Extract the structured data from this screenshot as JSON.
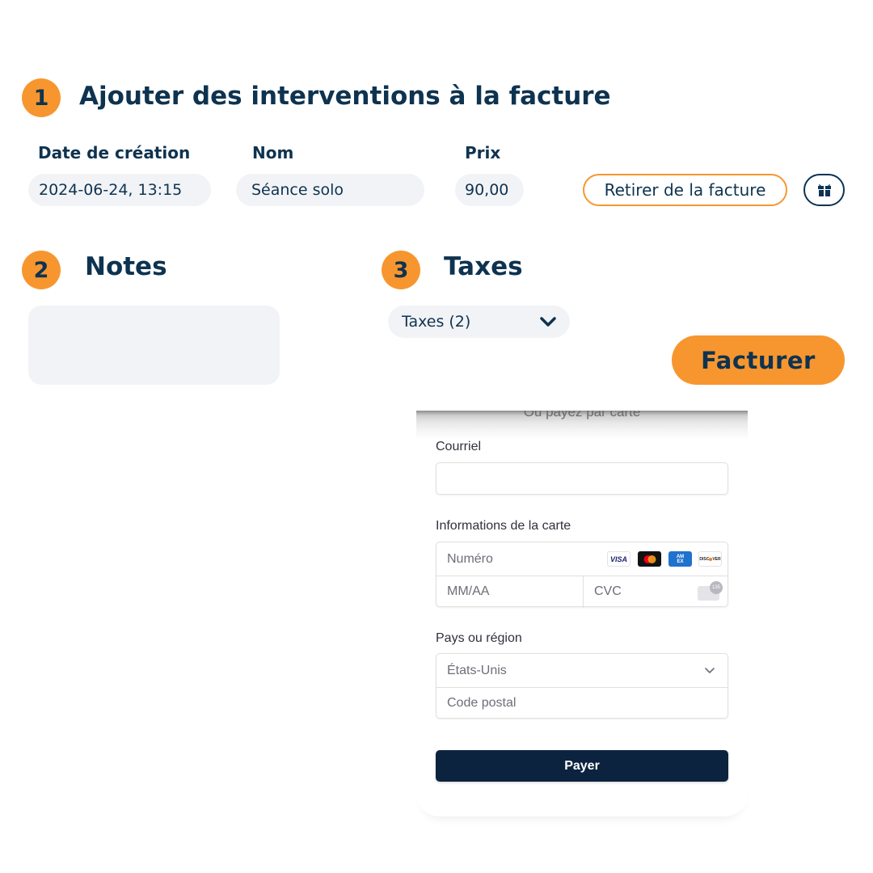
{
  "section1": {
    "number": "1",
    "title": "Ajouter des interventions à la facture",
    "columns": {
      "date": "Date de création",
      "name": "Nom",
      "price": "Prix"
    },
    "row": {
      "date": "2024-06-24, 13:15",
      "name": "Séance solo",
      "price": "90,00",
      "remove_label": "Retirer de la facture",
      "gift_icon": "gift-icon"
    }
  },
  "section2": {
    "number": "2",
    "title": "Notes",
    "notes_value": ""
  },
  "section3": {
    "number": "3",
    "title": "Taxes",
    "taxes_select": "Taxes (2)",
    "chevron_icon": "chevron-down-icon"
  },
  "invoice_button": "Facturer",
  "payment": {
    "top_text": "Ou payez par carte",
    "email_label": "Courriel",
    "email_value": "",
    "card_label": "Informations de la carte",
    "card_number_placeholder": "Numéro",
    "expiry_placeholder": "MM/AA",
    "cvc_placeholder": "CVC",
    "cvc_badge": "135",
    "card_brands": [
      "VISA",
      "MASTERCARD",
      "AMEX",
      "DISCOVER"
    ],
    "country_label": "Pays ou région",
    "country_value": "États-Unis",
    "postal_placeholder": "Code postal",
    "pay_button": "Payer"
  },
  "colors": {
    "accent_orange": "#f7962f",
    "navy": "#0e3350",
    "pill_bg": "#f2f3f6",
    "pay_button_bg": "#0c2340"
  }
}
